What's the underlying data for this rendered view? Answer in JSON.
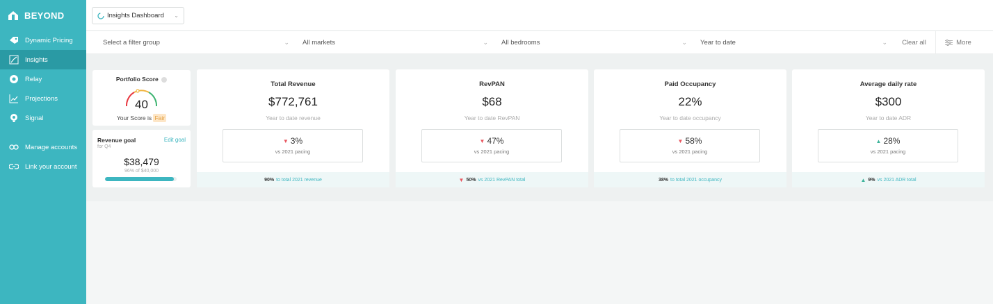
{
  "brand": {
    "name": "BEYOND"
  },
  "sidebar": {
    "items": [
      {
        "label": "Dynamic Pricing",
        "icon": "tag-icon"
      },
      {
        "label": "Insights",
        "icon": "chart-icon",
        "active": true
      },
      {
        "label": "Relay",
        "icon": "relay-icon"
      },
      {
        "label": "Projections",
        "icon": "projections-icon"
      },
      {
        "label": "Signal",
        "icon": "signal-icon"
      }
    ],
    "secondary": [
      {
        "label": "Manage accounts",
        "icon": "link-icon"
      },
      {
        "label": "Link your account",
        "icon": "unlink-icon"
      }
    ]
  },
  "header": {
    "dashboard_select": "Insights Dashboard"
  },
  "filters": {
    "filter_group": "Select a filter group",
    "markets": "All markets",
    "bedrooms": "All bedrooms",
    "period": "Year to date",
    "clear_all": "Clear all",
    "more": "More"
  },
  "portfolio": {
    "title": "Portfolio Score",
    "score": "40",
    "score_text": "Your Score is",
    "rating": "Fair"
  },
  "revenue_goal": {
    "title": "Revenue goal",
    "edit": "Edit goal",
    "period": "for Q4",
    "value": "$38,479",
    "progress_text": "96% of $40,000",
    "progress": 0.96
  },
  "kpis": [
    {
      "title": "Total Revenue",
      "value": "$772,761",
      "subtitle": "Year to date revenue",
      "change": "3%",
      "direction": "down",
      "pacing": "vs 2021 pacing",
      "footer_value": "90%",
      "footer_text": "to total 2021 revenue",
      "footer_direction": ""
    },
    {
      "title": "RevPAN",
      "value": "$68",
      "subtitle": "Year to date RevPAN",
      "change": "47%",
      "direction": "down",
      "pacing": "vs 2021 pacing",
      "footer_value": "50%",
      "footer_text": "vs 2021 RevPAN total",
      "footer_direction": "down"
    },
    {
      "title": "Paid Occupancy",
      "value": "22%",
      "subtitle": "Year to date occupancy",
      "change": "58%",
      "direction": "down",
      "pacing": "vs 2021 pacing",
      "footer_value": "38%",
      "footer_text": "to total 2021 occupancy",
      "footer_direction": ""
    },
    {
      "title": "Average daily rate",
      "value": "$300",
      "subtitle": "Year to date ADR",
      "change": "28%",
      "direction": "up",
      "pacing": "vs 2021 pacing",
      "footer_value": "9%",
      "footer_text": "vs 2021 ADR total",
      "footer_direction": "up"
    }
  ],
  "colors": {
    "accent": "#3db6c0",
    "down": "#e8565f",
    "up": "#3cb39a",
    "fair": "#e3a041"
  }
}
